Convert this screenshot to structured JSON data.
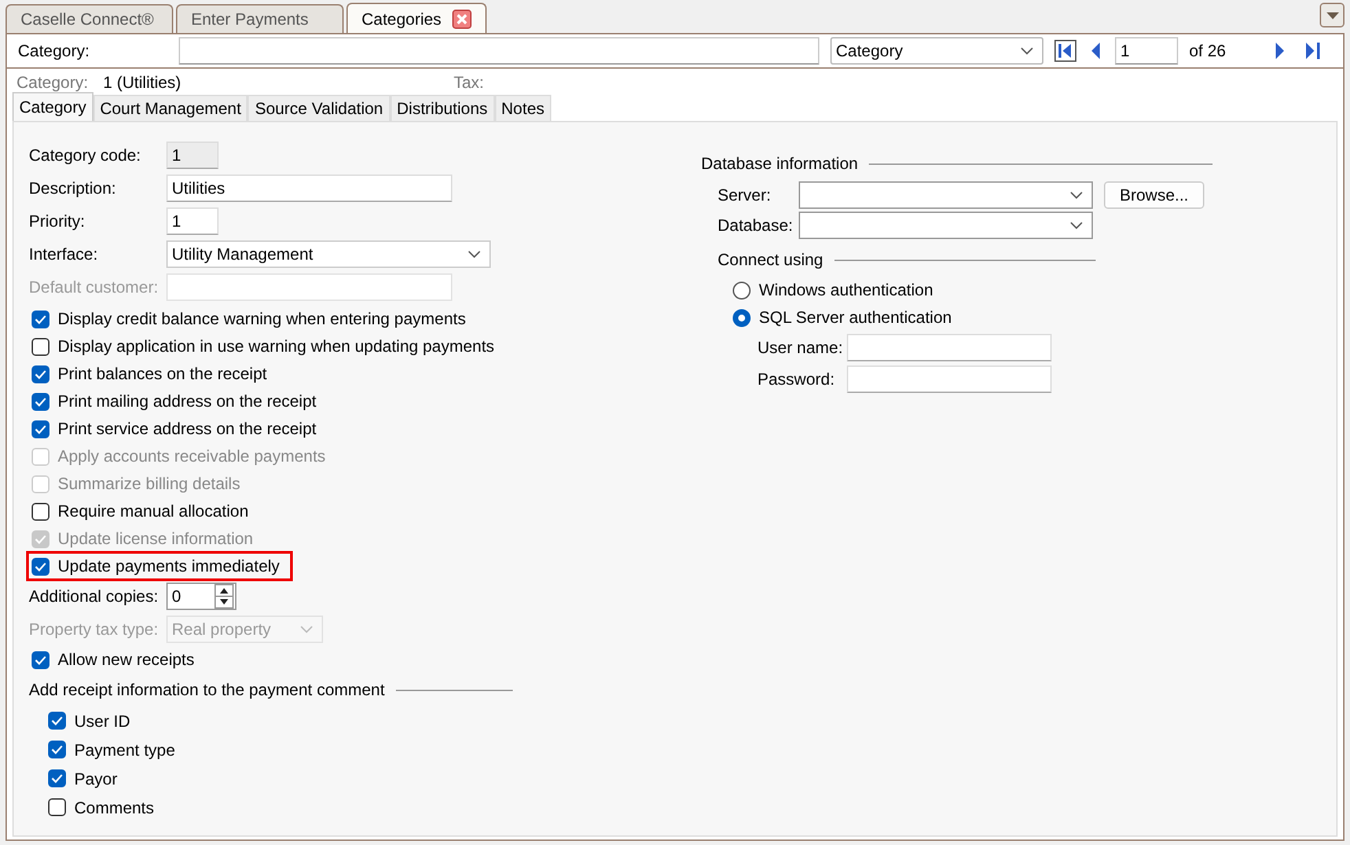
{
  "app_tabs": [
    {
      "label": "Caselle Connect®",
      "selected": false,
      "closable": false
    },
    {
      "label": "Enter Payments",
      "selected": false,
      "closable": false
    },
    {
      "label": "Categories",
      "selected": true,
      "closable": true
    }
  ],
  "search": {
    "label": "Category:",
    "search_by": "Category",
    "page": "1",
    "page_count": "of 26"
  },
  "info": {
    "label": "Category:",
    "value": "1 (Utilities)",
    "tax_label": "Tax:"
  },
  "tabs": [
    {
      "label": "Category",
      "selected": true
    },
    {
      "label": "Court Management",
      "selected": false
    },
    {
      "label": "Source Validation",
      "selected": false
    },
    {
      "label": "Distributions",
      "selected": false
    },
    {
      "label": "Notes",
      "selected": false
    }
  ],
  "fields": [
    {
      "kind": "code",
      "label": "Category code:",
      "value": "1",
      "disabled": false
    },
    {
      "kind": "text",
      "label": "Description:",
      "value": "Utilities",
      "disabled": false
    },
    {
      "kind": "number",
      "label": "Priority:",
      "value": "1",
      "disabled": false
    },
    {
      "kind": "select",
      "label": "Interface:",
      "value": "Utility Management",
      "disabled": false
    },
    {
      "kind": "text",
      "label": "Default customer:",
      "disabled": true
    }
  ],
  "checkboxes": [
    {
      "label": "Display credit balance warning when entering payments",
      "checked": true,
      "disabled": false,
      "highlighted": false
    },
    {
      "label": "Display application in use warning when updating payments",
      "checked": false,
      "disabled": false,
      "highlighted": false
    },
    {
      "label": "Print balances on the receipt",
      "checked": true,
      "disabled": false,
      "highlighted": false
    },
    {
      "label": "Print mailing address on the receipt",
      "checked": true,
      "disabled": false,
      "highlighted": false
    },
    {
      "label": "Print service address on the receipt",
      "checked": true,
      "disabled": false,
      "highlighted": false
    },
    {
      "label": "Apply accounts receivable payments",
      "checked": false,
      "disabled": true,
      "highlighted": false
    },
    {
      "label": "Summarize billing details",
      "checked": false,
      "disabled": true,
      "highlighted": false
    },
    {
      "label": "Require manual allocation",
      "checked": false,
      "disabled": false,
      "highlighted": false
    },
    {
      "label": "Update license information",
      "checked": true,
      "disabled": true,
      "highlighted": false
    },
    {
      "label": "Update payments immediately",
      "checked": true,
      "disabled": false,
      "highlighted": true
    }
  ],
  "fields_2": [
    {
      "kind": "spin",
      "label": "Additional copies:",
      "value": "0",
      "disabled": false
    },
    {
      "kind": "select",
      "label": "Property tax type:",
      "value": "Real property",
      "disabled": true
    }
  ],
  "allow_new_receipts": {
    "label": "Allow new receipts",
    "checked": true
  },
  "comment_group": {
    "title": "Add receipt information to the payment comment",
    "options": [
      {
        "label": "User ID",
        "checked": true
      },
      {
        "label": "Payment type",
        "checked": true
      },
      {
        "label": "Payor",
        "checked": true
      },
      {
        "label": "Comments",
        "checked": false
      }
    ]
  },
  "database": {
    "title": "Database information",
    "server_label": "Server:",
    "browse": "Browse...",
    "database_label": "Database:",
    "connect_title": "Connect using",
    "options": [
      {
        "label": "Windows authentication",
        "selected": false
      },
      {
        "label": "SQL Server authentication",
        "selected": true
      }
    ],
    "user_label": "User name:",
    "password_label": "Password:"
  }
}
